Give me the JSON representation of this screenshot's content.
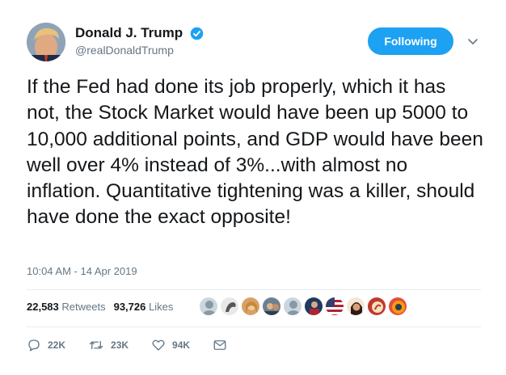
{
  "user": {
    "display_name": "Donald J. Trump",
    "handle": "@realDonaldTrump",
    "verified": true,
    "avatar_icon": "profile-photo"
  },
  "follow_button": {
    "label": "Following"
  },
  "tweet": {
    "text": "If the Fed had done its job properly, which it has not, the Stock Market would have been up 5000 to 10,000 additional points, and GDP would have been well  over 4% instead of 3%...with almost no inflation. Quantitative tightening was a killer, should have done the exact opposite!",
    "timestamp": "10:04 AM - 14 Apr 2019"
  },
  "stats": {
    "retweets_count": "22,583",
    "retweets_label": "Retweets",
    "likes_count": "93,726",
    "likes_label": "Likes",
    "liker_faces": 10
  },
  "actions": {
    "reply_count": "22K",
    "retweet_count": "23K",
    "like_count": "94K"
  },
  "colors": {
    "accent": "#1da1f2",
    "muted": "#657786",
    "text": "#14171a",
    "divider": "#e6ecf0"
  }
}
